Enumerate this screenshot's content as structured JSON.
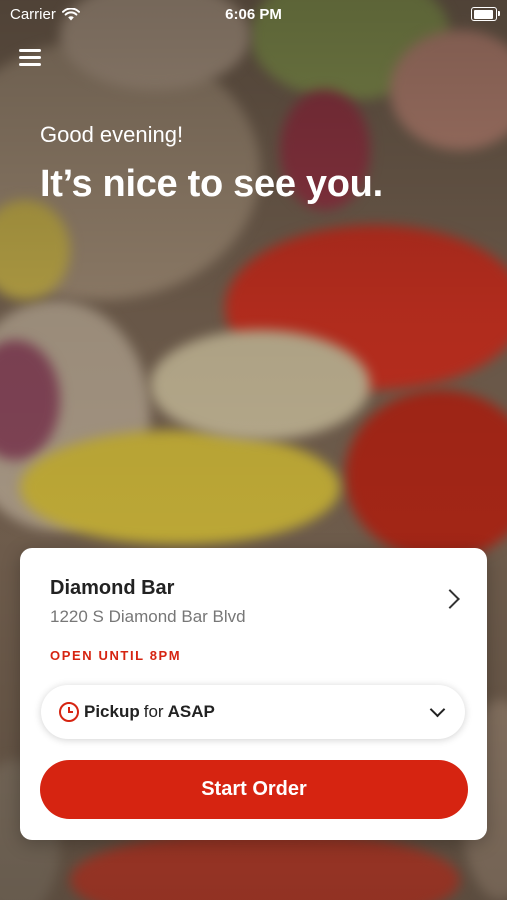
{
  "status_bar": {
    "carrier": "Carrier",
    "time": "6:06 PM"
  },
  "header": {
    "menu_icon": "hamburger-menu-icon"
  },
  "hero": {
    "greeting": "Good evening!",
    "headline": "It’s nice to see you."
  },
  "store": {
    "name": "Diamond Bar",
    "address": "1220 S Diamond Bar Blvd",
    "hours_status": "OPEN UNTIL 8PM"
  },
  "order_mode": {
    "method": "Pickup",
    "connector": "for",
    "time": "ASAP"
  },
  "actions": {
    "start_order": "Start Order"
  },
  "colors": {
    "accent": "#d62411",
    "card": "#ffffff"
  }
}
